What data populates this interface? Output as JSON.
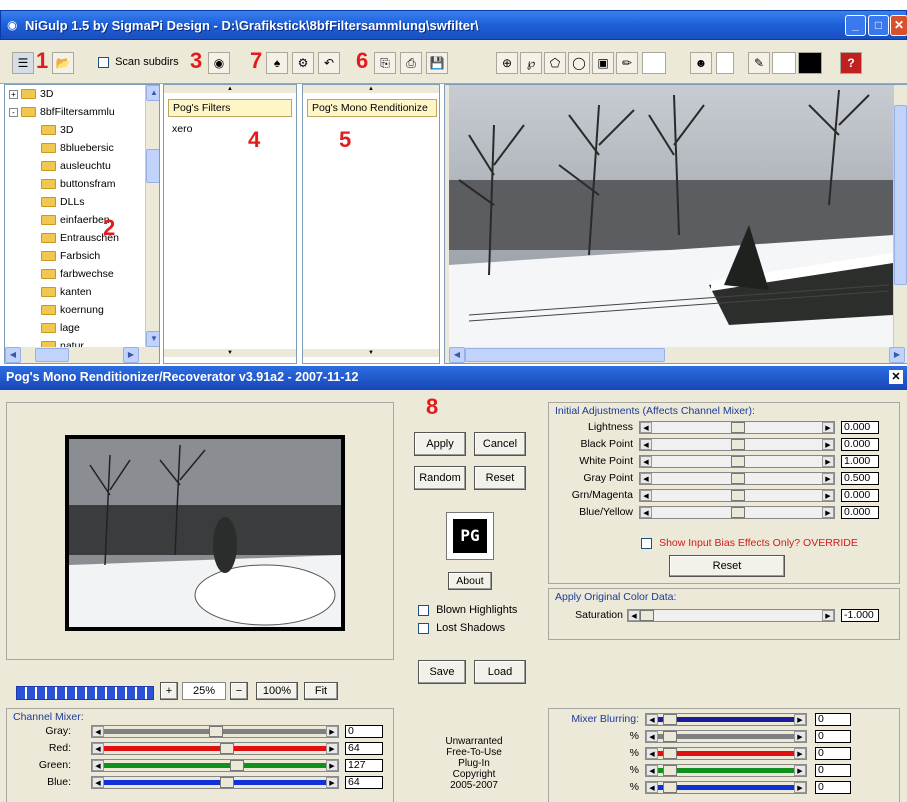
{
  "window": {
    "title": "NiGulp 1.5 by SigmaPi Design   - D:\\Grafikstick\\8bfFiltersammlung\\swfilter\\"
  },
  "toolbar": {
    "scan_subdirs_label": "Scan subdirs"
  },
  "annotations": [
    "1",
    "2",
    "3",
    "4",
    "5",
    "6",
    "7",
    "8"
  ],
  "tree": {
    "items": [
      {
        "label": "3D",
        "level": 0,
        "expander": "+"
      },
      {
        "label": "8bfFiltersammlu",
        "level": 0,
        "expander": "-"
      },
      {
        "label": "3D",
        "level": 1
      },
      {
        "label": "8bluebersic",
        "level": 1
      },
      {
        "label": "ausleuchtu",
        "level": 1
      },
      {
        "label": "buttonsfram",
        "level": 1
      },
      {
        "label": "DLLs",
        "level": 1
      },
      {
        "label": "einfaerben",
        "level": 1
      },
      {
        "label": "Entrauschen",
        "level": 1
      },
      {
        "label": "Farbsich",
        "level": 1
      },
      {
        "label": "farbwechse",
        "level": 1
      },
      {
        "label": "kanten",
        "level": 1
      },
      {
        "label": "koernung",
        "level": 1
      },
      {
        "label": "lage",
        "level": 1
      },
      {
        "label": "natur",
        "level": 1
      }
    ]
  },
  "filters": {
    "header": "Pog's Filters",
    "items": [
      "xero"
    ]
  },
  "plugins": {
    "header": "Pog's Mono Renditionize"
  },
  "dialog": {
    "title": "Pog's Mono Renditionizer/Recoverator v3.91a2 - 2007-11-12",
    "buttons": {
      "apply": "Apply",
      "cancel": "Cancel",
      "random": "Random",
      "reset": "Reset",
      "about": "About",
      "save": "Save",
      "load": "Load"
    },
    "logo": "PG",
    "blown_highlights": "Blown Highlights",
    "lost_shadows": "Lost Shadows",
    "zoom": {
      "value": "25%",
      "full": "100%",
      "fit": "Fit",
      "plus": "+",
      "minus": "−"
    },
    "initial": {
      "title": "Initial Adjustments (Affects Channel Mixer):",
      "rows": [
        {
          "label": "Lightness",
          "value": "0.000",
          "pos": 0.5
        },
        {
          "label": "Black Point",
          "value": "0.000",
          "pos": 0.5
        },
        {
          "label": "White Point",
          "value": "1.000",
          "pos": 0.5
        },
        {
          "label": "Gray Point",
          "value": "0.500",
          "pos": 0.5
        },
        {
          "label": "Grn/Magenta",
          "value": "0.000",
          "pos": 0.5
        },
        {
          "label": "Blue/Yellow",
          "value": "0.000",
          "pos": 0.5
        }
      ],
      "override_label": "Show Input Bias Effects Only? OVERRIDE",
      "reset": "Reset"
    },
    "original": {
      "title": "Apply Original Color Data:",
      "saturation_label": "Saturation",
      "saturation_value": "-1.000",
      "pos": 0.0
    },
    "channel_mixer": {
      "title": "Channel Mixer:",
      "rows": [
        {
          "label": "Gray:",
          "value": "0",
          "color": "#808080",
          "pos": 0.5
        },
        {
          "label": "Red:",
          "value": "64",
          "color": "#e01010",
          "pos": 0.55
        },
        {
          "label": "Green:",
          "value": "127",
          "color": "#10901c",
          "pos": 0.6
        },
        {
          "label": "Blue:",
          "value": "64",
          "color": "#1030d8",
          "pos": 0.55
        }
      ]
    },
    "notice": [
      "Unwarranted",
      "Free-To-Use",
      "Plug-In",
      "Copyright",
      "2005-2007"
    ],
    "mixer_blurring": {
      "title": "Mixer Blurring:",
      "rows": [
        {
          "label": "",
          "value": "0",
          "color": "#1c1c98"
        },
        {
          "label": "%",
          "value": "0",
          "color": "#808080"
        },
        {
          "label": "%",
          "value": "0",
          "color": "#e01010"
        },
        {
          "label": "%",
          "value": "0",
          "color": "#10901c"
        },
        {
          "label": "%",
          "value": "0",
          "color": "#1030d8"
        }
      ]
    }
  }
}
